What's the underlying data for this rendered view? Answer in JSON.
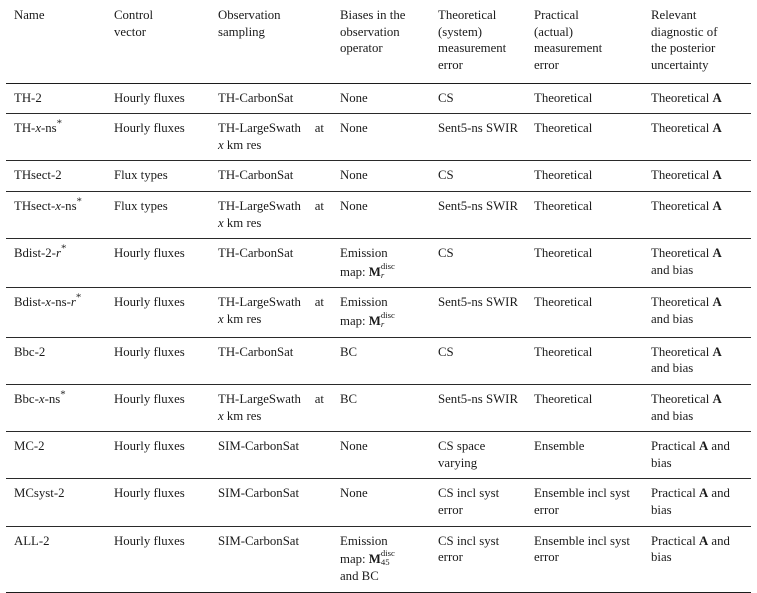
{
  "table": {
    "columns": [
      "Name",
      "Control vector",
      "Observation sampling",
      "Biases in the observation operator",
      "Theoretical (system) measurement error",
      "Practical (actual) measurement error",
      "Relevant diagnostic of the posterior uncertainty"
    ],
    "headers": {
      "name": "Name",
      "control_vector": "Control\nvector",
      "observation_sampling": "Observation\nsampling",
      "biases": "Biases in the\nobservation\noperator",
      "theoretical_error": "Theoretical\n(system)\nmeasurement\nerror",
      "practical_error": "Practical\n(actual)\nmeasurement\nerror",
      "diagnostic": "Relevant\ndiagnostic of\nthe posterior\nuncertainty"
    },
    "rows": [
      {
        "name": "TH-2",
        "name_parts": [
          {
            "t": "TH-2",
            "style": "plain"
          }
        ],
        "control_vector": "Hourly fluxes",
        "observation_sampling": "TH-CarbonSat",
        "observation_justified": false,
        "biases": "None",
        "biases_math": null,
        "theoretical_error": "CS",
        "practical_error": "Theoretical",
        "diagnostic": "Theoretical A",
        "diagnostic_bold": "A",
        "diagnostic_pre": "Theoretical ",
        "diagnostic_post": ""
      },
      {
        "name": "TH-x-ns*",
        "name_parts": [
          {
            "t": "TH-",
            "style": "plain"
          },
          {
            "t": "x",
            "style": "italic"
          },
          {
            "t": "-ns",
            "style": "plain"
          },
          {
            "t": "*",
            "style": "star"
          }
        ],
        "control_vector": "Hourly fluxes",
        "observation_sampling": "TH-LargeSwath at x km res",
        "observation_justified": true,
        "observation_line1": "TH-LargeSwath at",
        "observation_line2_pre": "",
        "observation_line2_italic": "x",
        "observation_line2_post": " km res",
        "biases": "None",
        "biases_math": null,
        "theoretical_error": "Sent5-ns SWIR",
        "practical_error": "Theoretical",
        "diagnostic": "Theoretical A",
        "diagnostic_bold": "A",
        "diagnostic_pre": "Theoretical ",
        "diagnostic_post": ""
      },
      {
        "name": "THsect-2",
        "name_parts": [
          {
            "t": "THsect-2",
            "style": "plain"
          }
        ],
        "control_vector": "Flux types",
        "observation_sampling": "TH-CarbonSat",
        "observation_justified": false,
        "biases": "None",
        "biases_math": null,
        "theoretical_error": "CS",
        "practical_error": "Theoretical",
        "diagnostic": "Theoretical A",
        "diagnostic_bold": "A",
        "diagnostic_pre": "Theoretical ",
        "diagnostic_post": ""
      },
      {
        "name": "THsect-x-ns*",
        "name_parts": [
          {
            "t": "THsect-",
            "style": "plain"
          },
          {
            "t": "x",
            "style": "italic"
          },
          {
            "t": "-ns",
            "style": "plain"
          },
          {
            "t": "*",
            "style": "star"
          }
        ],
        "control_vector": "Flux types",
        "observation_sampling": "TH-LargeSwath at x km res",
        "observation_justified": true,
        "observation_line1": "TH-LargeSwath at",
        "observation_line2_pre": "",
        "observation_line2_italic": "x",
        "observation_line2_post": " km res",
        "biases": "None",
        "biases_math": null,
        "theoretical_error": "Sent5-ns SWIR",
        "practical_error": "Theoretical",
        "diagnostic": "Theoretical A",
        "diagnostic_bold": "A",
        "diagnostic_pre": "Theoretical ",
        "diagnostic_post": ""
      },
      {
        "name": "Bdist-2-r*",
        "name_parts": [
          {
            "t": "Bdist-2-",
            "style": "plain"
          },
          {
            "t": "r",
            "style": "italic"
          },
          {
            "t": "*",
            "style": "star"
          }
        ],
        "control_vector": "Hourly fluxes",
        "observation_sampling": "TH-CarbonSat",
        "observation_justified": false,
        "biases": "Emission map: M_r^disc",
        "biases_math": {
          "label": "Emission",
          "label2": "map: ",
          "symbol": "M",
          "sup": "disc",
          "sub": "r",
          "sub_italic": true,
          "tail": ""
        },
        "theoretical_error": "CS",
        "practical_error": "Theoretical",
        "diagnostic": "Theoretical A and bias",
        "diagnostic_bold": "A",
        "diagnostic_pre": "Theoretical ",
        "diagnostic_post": " and bias"
      },
      {
        "name": "Bdist-x-ns-r*",
        "name_parts": [
          {
            "t": "Bdist-",
            "style": "plain"
          },
          {
            "t": "x",
            "style": "italic"
          },
          {
            "t": "-ns-",
            "style": "plain"
          },
          {
            "t": "r",
            "style": "italic"
          },
          {
            "t": "*",
            "style": "star"
          }
        ],
        "control_vector": "Hourly fluxes",
        "observation_sampling": "TH-LargeSwath at x km res",
        "observation_justified": true,
        "observation_line1": "TH-LargeSwath at",
        "observation_line2_pre": "",
        "observation_line2_italic": "x",
        "observation_line2_post": " km res",
        "biases": "Emission map: M_r^disc",
        "biases_math": {
          "label": "Emission",
          "label2": "map: ",
          "symbol": "M",
          "sup": "disc",
          "sub": "r",
          "sub_italic": true,
          "tail": ""
        },
        "theoretical_error": "Sent5-ns SWIR",
        "practical_error": "Theoretical",
        "diagnostic": "Theoretical A and bias",
        "diagnostic_bold": "A",
        "diagnostic_pre": "Theoretical ",
        "diagnostic_post": " and bias"
      },
      {
        "name": "Bbc-2",
        "name_parts": [
          {
            "t": "Bbc-2",
            "style": "plain"
          }
        ],
        "control_vector": "Hourly fluxes",
        "observation_sampling": "TH-CarbonSat",
        "observation_justified": false,
        "biases": "BC",
        "biases_math": null,
        "theoretical_error": "CS",
        "practical_error": "Theoretical",
        "diagnostic": "Theoretical A and bias",
        "diagnostic_bold": "A",
        "diagnostic_pre": "Theoretical ",
        "diagnostic_post": " and bias"
      },
      {
        "name": "Bbc-x-ns*",
        "name_parts": [
          {
            "t": "Bbc-",
            "style": "plain"
          },
          {
            "t": "x",
            "style": "italic"
          },
          {
            "t": "-ns",
            "style": "plain"
          },
          {
            "t": "*",
            "style": "star"
          }
        ],
        "control_vector": "Hourly fluxes",
        "observation_sampling": "TH-LargeSwath at x km res",
        "observation_justified": true,
        "observation_line1": "TH-LargeSwath at",
        "observation_line2_pre": "",
        "observation_line2_italic": "x",
        "observation_line2_post": " km res",
        "biases": "BC",
        "biases_math": null,
        "theoretical_error": "Sent5-ns SWIR",
        "practical_error": "Theoretical",
        "diagnostic": "Theoretical A and bias",
        "diagnostic_bold": "A",
        "diagnostic_pre": "Theoretical ",
        "diagnostic_post": " and bias"
      },
      {
        "name": "MC-2",
        "name_parts": [
          {
            "t": "MC-2",
            "style": "plain"
          }
        ],
        "control_vector": "Hourly fluxes",
        "observation_sampling": "SIM-CarbonSat",
        "observation_justified": false,
        "biases": "None",
        "biases_math": null,
        "theoretical_error": "CS space varying",
        "practical_error": "Ensemble",
        "diagnostic": "Practical A and bias",
        "diagnostic_bold": "A",
        "diagnostic_pre": "Practical ",
        "diagnostic_post": " and bias"
      },
      {
        "name": "MCsyst-2",
        "name_parts": [
          {
            "t": "MCsyst-2",
            "style": "plain"
          }
        ],
        "control_vector": "Hourly fluxes",
        "observation_sampling": "SIM-CarbonSat",
        "observation_justified": false,
        "biases": "None",
        "biases_math": null,
        "theoretical_error": "CS incl syst error",
        "practical_error": "Ensemble incl syst error",
        "diagnostic": "Practical A and bias",
        "diagnostic_bold": "A",
        "diagnostic_pre": "Practical ",
        "diagnostic_post": " and bias"
      },
      {
        "name": "ALL-2",
        "name_parts": [
          {
            "t": "ALL-2",
            "style": "plain"
          }
        ],
        "control_vector": "Hourly fluxes",
        "observation_sampling": "SIM-CarbonSat",
        "observation_justified": false,
        "biases": "Emission map: M_45^disc and BC",
        "biases_math": {
          "label": "Emission",
          "label2": "map: ",
          "symbol": "M",
          "sup": "disc",
          "sub": "45",
          "sub_italic": false,
          "tail": "and BC"
        },
        "theoretical_error": "CS incl syst error",
        "practical_error": "Ensemble incl syst error",
        "diagnostic": "Practical A and bias",
        "diagnostic_bold": "A",
        "diagnostic_pre": "Practical ",
        "diagnostic_post": " and bias"
      }
    ]
  },
  "style": {
    "text_color": "#1a1a1a",
    "rule_color": "#1c1c1c",
    "background": "#ffffff"
  }
}
